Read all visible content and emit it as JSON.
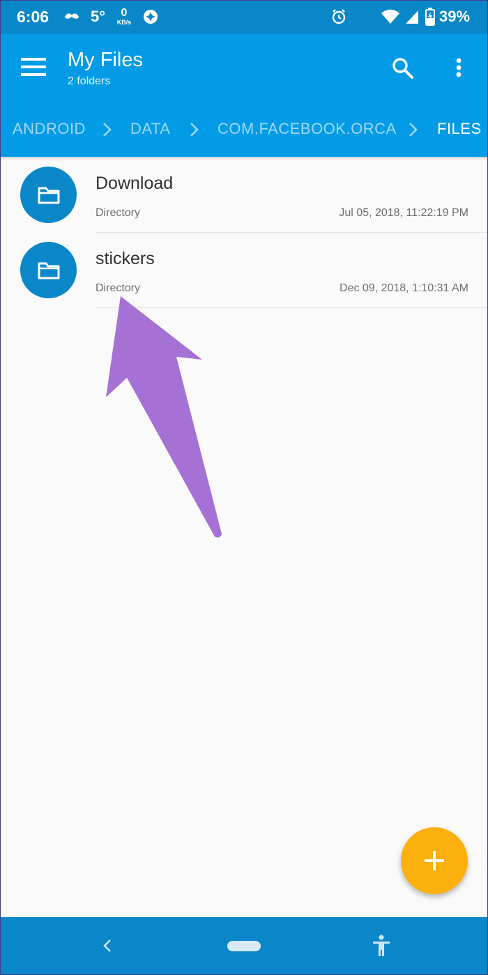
{
  "status_bar": {
    "time": "6:06",
    "temperature": "5°",
    "net_speed_value": "0",
    "net_speed_unit": "KB/s",
    "battery_percent": "39%",
    "icons": [
      "mustache-icon",
      "aperture-icon",
      "alarm-icon",
      "wifi-icon",
      "signal-icon",
      "battery-charging-icon"
    ]
  },
  "app_bar": {
    "title": "My Files",
    "subtitle": "2 folders",
    "icons": [
      "menu-icon",
      "search-icon",
      "more-vert-icon"
    ],
    "background_color": "#039be5"
  },
  "breadcrumbs": [
    "ANDROID",
    "DATA",
    "COM.FACEBOOK.ORCA",
    "FILES"
  ],
  "files": [
    {
      "name": "Download",
      "type": "Directory",
      "modified": "Jul 05, 2018, 11:22:19 PM",
      "icon": "folder-icon"
    },
    {
      "name": "stickers",
      "type": "Directory",
      "modified": "Dec 09, 2018, 1:10:31 AM",
      "icon": "folder-icon"
    }
  ],
  "annotation": {
    "icon": "arrow-annotation",
    "color": "#a571d4"
  },
  "fab": {
    "icon": "plus-icon",
    "color": "#fbb00e"
  },
  "nav_bar": {
    "icons": [
      "back-icon",
      "home-pill",
      "accessibility-icon"
    ]
  }
}
